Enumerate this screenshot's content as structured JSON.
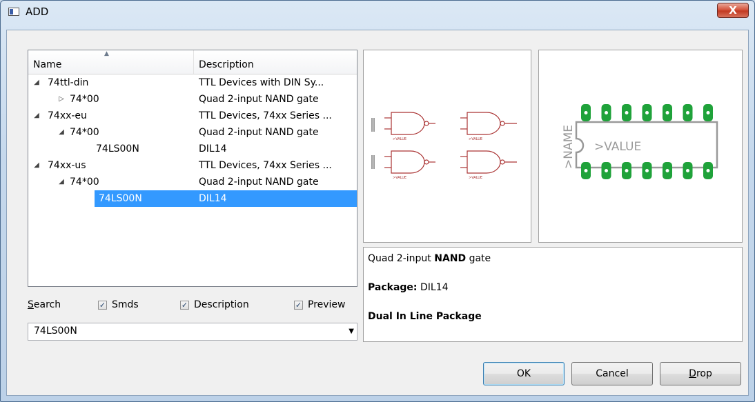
{
  "window": {
    "title": "ADD",
    "close_glyph": "X"
  },
  "tree": {
    "columns": {
      "name": "Name",
      "description": "Description"
    },
    "rows": [
      {
        "name": "74ttl-din",
        "description": "TTL Devices with DIN Sy...",
        "expander": "◢"
      },
      {
        "name": "74*00",
        "description": "Quad 2-input NAND gate",
        "expander": "▷"
      },
      {
        "name": "74xx-eu",
        "description": "TTL Devices, 74xx Series ...",
        "expander": "◢"
      },
      {
        "name": "74*00",
        "description": "Quad 2-input NAND gate",
        "expander": "◢"
      },
      {
        "name": "74LS00N",
        "description": "DIL14",
        "expander": ""
      },
      {
        "name": "74xx-us",
        "description": "TTL Devices, 74xx Series ...",
        "expander": "◢"
      },
      {
        "name": "74*00",
        "description": "Quad 2-input NAND gate",
        "expander": "◢"
      },
      {
        "name": "74LS00N",
        "description": "DIL14",
        "expander": ""
      }
    ]
  },
  "search": {
    "label": "Search",
    "smds": {
      "label": "Smds",
      "checked": true
    },
    "description": {
      "label": "Description",
      "checked": true
    },
    "preview": {
      "label": "Preview",
      "checked": true
    },
    "value": "74LS00N"
  },
  "package_preview": {
    "name_text": ">NAME",
    "value_text": ">VALUE",
    "pad_color": "#1fa23a"
  },
  "info": {
    "line1_pre": "Quad 2-input ",
    "line1_bold": "NAND",
    "line1_post": " gate",
    "package_label": "Package:",
    "package_value": " DIL14",
    "package_desc": "Dual In Line Package"
  },
  "buttons": {
    "ok": "OK",
    "cancel": "Cancel",
    "drop": "Drop"
  }
}
